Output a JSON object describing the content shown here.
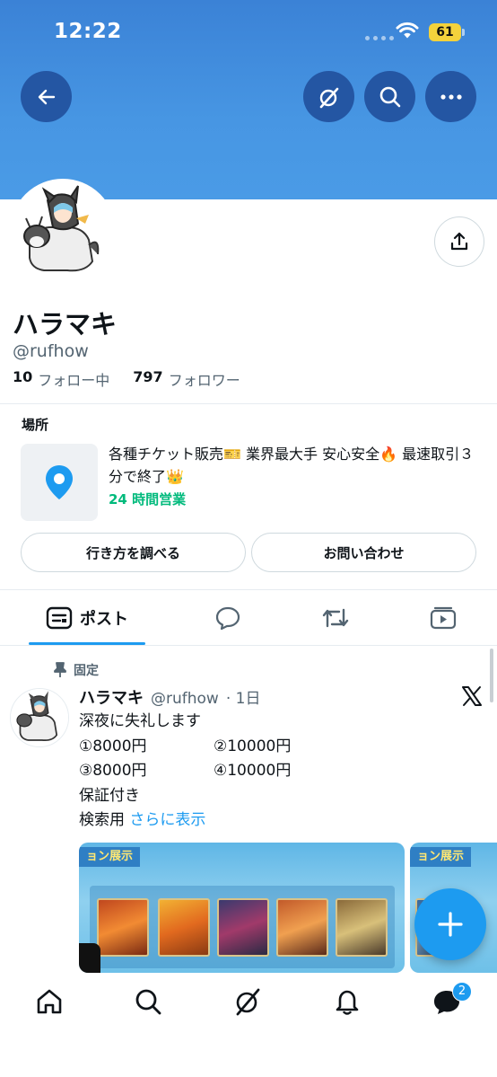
{
  "status_bar": {
    "time": "12:22",
    "battery": "61"
  },
  "header": {
    "back_icon": "arrow-left-icon",
    "actions": [
      "grok-icon",
      "search-icon",
      "more-icon"
    ]
  },
  "profile": {
    "name": "ハラマキ",
    "handle": "@rufhow",
    "following_count": "10",
    "following_label": "フォロー中",
    "followers_count": "797",
    "followers_label": "フォロワー"
  },
  "location": {
    "title": "場所",
    "description": "各種チケット販売🎫 業界最大手 安心安全🔥 最速取引３分で終了👑",
    "hours": "24 時間営業",
    "directions_button": "行き方を調べる",
    "contact_button": "お問い合わせ"
  },
  "tabs": [
    {
      "label": "ポスト",
      "icon": "posts-icon",
      "active": true
    },
    {
      "label": "",
      "icon": "reply-icon"
    },
    {
      "label": "",
      "icon": "repost-icon"
    },
    {
      "label": "",
      "icon": "media-icon"
    }
  ],
  "pinned_post": {
    "pin_label": "固定",
    "author_name": "ハラマキ",
    "author_handle": "@rufhow",
    "time": "· 1日",
    "line1": "深夜に失礼します",
    "price1": "①8000円",
    "price2": "②10000円",
    "price3": "③8000円",
    "price4": "④10000円",
    "line4": "保証付き",
    "line5": "検索用",
    "show_more": "さらに表示",
    "media_banner": "ョン展示",
    "media_banner2": "ョン展示"
  },
  "bottom_nav": {
    "items": [
      "home-icon",
      "search-icon",
      "grok-icon",
      "notifications-icon",
      "messages-icon"
    ],
    "messages_badge": "2"
  },
  "colors": {
    "accent": "#1d9bf0",
    "banner": "#4796e3",
    "hours": "#00ba7c"
  }
}
